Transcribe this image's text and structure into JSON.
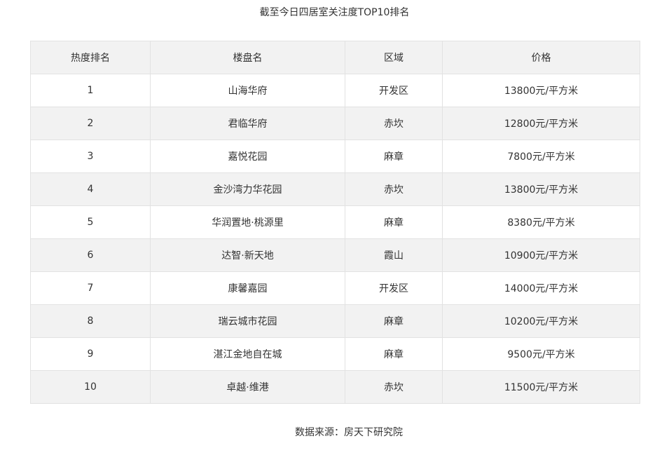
{
  "title": "截至今日四居室关注度TOP10排名",
  "table": {
    "headers": [
      "热度排名",
      "楼盘名",
      "区域",
      "价格"
    ],
    "rows": [
      {
        "rank": "1",
        "name": "山海华府",
        "area": "开发区",
        "price": "13800元/平方米"
      },
      {
        "rank": "2",
        "name": "君临华府",
        "area": "赤坎",
        "price": "12800元/平方米"
      },
      {
        "rank": "3",
        "name": "嘉悦花园",
        "area": "麻章",
        "price": "7800元/平方米"
      },
      {
        "rank": "4",
        "name": "金沙湾力华花园",
        "area": "赤坎",
        "price": "13800元/平方米"
      },
      {
        "rank": "5",
        "name": "华润置地·桃源里",
        "area": "麻章",
        "price": "8380元/平方米"
      },
      {
        "rank": "6",
        "name": "达智·新天地",
        "area": "霞山",
        "price": "10900元/平方米"
      },
      {
        "rank": "7",
        "name": "康馨嘉园",
        "area": "开发区",
        "price": "14000元/平方米"
      },
      {
        "rank": "8",
        "name": "瑞云城市花园",
        "area": "麻章",
        "price": "10200元/平方米"
      },
      {
        "rank": "9",
        "name": "湛江金地自在城",
        "area": "麻章",
        "price": "9500元/平方米"
      },
      {
        "rank": "10",
        "name": "卓越·维港",
        "area": "赤坎",
        "price": "11500元/平方米"
      }
    ]
  },
  "source": "数据来源：房天下研究院"
}
